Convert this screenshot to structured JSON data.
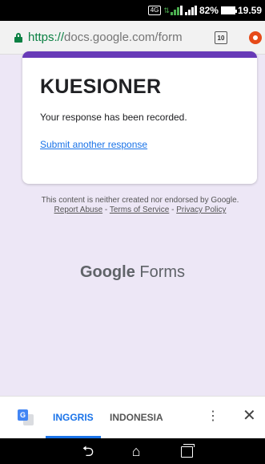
{
  "status_bar": {
    "network": "4G",
    "battery": "82%",
    "time": "19.59"
  },
  "browser": {
    "url_scheme": "https://",
    "url_rest": "docs.google.com/form",
    "tab_count": "10"
  },
  "form": {
    "title": "KUESIONER",
    "message": "Your response has been recorded.",
    "submit_another": "Submit another response",
    "accent_color": "#673ab7"
  },
  "disclaimer": {
    "text_before": "This content is neither created nor endorsed by Google.",
    "report_abuse": "Report Abuse",
    "sep1": " - ",
    "terms": "Terms of Service",
    "sep2": " - ",
    "privacy": "Privacy Policy"
  },
  "branding": {
    "google": "Google",
    "forms": "Forms"
  },
  "translate_bar": {
    "lang_source": "INGGRIS",
    "lang_target": "INDONESIA",
    "menu_glyph": "⋮",
    "close_glyph": "✕",
    "icon": "google-translate-icon"
  },
  "nav_bar": {
    "back_glyph": "⮌",
    "home_glyph": "⌂",
    "icons": [
      "back-icon",
      "home-icon",
      "recent-apps-icon"
    ]
  }
}
